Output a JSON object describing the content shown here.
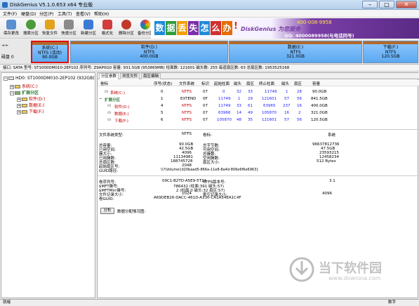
{
  "window": {
    "title": "DiskGenius V5.1.0.653 x64 专业版",
    "min": "–",
    "max": "□",
    "close": "✕"
  },
  "menu": [
    "文件(F)",
    "硬盘(D)",
    "分区(P)",
    "工具(T)",
    "查看(V)",
    "帮助(H)"
  ],
  "toolbar": [
    {
      "label": "保存更改",
      "color": "#5a8fd0"
    },
    {
      "label": "搜索分区",
      "color": "#4c9a3c"
    },
    {
      "label": "恢复文件",
      "color": "#e3a21a"
    },
    {
      "label": "快速分区",
      "color": "#8a8a8a"
    },
    {
      "label": "新建分区",
      "color": "#3a7bd5"
    },
    {
      "label": "格式化",
      "color": "#d23c3c"
    },
    {
      "label": "删除分区",
      "color": "#c0392b"
    },
    {
      "label": "备份分区",
      "color": "#2f7d3a"
    }
  ],
  "banner": {
    "tiles": [
      {
        "ch": "数",
        "color": "#1f8ad8"
      },
      {
        "ch": "据",
        "color": "#2e9e3e"
      },
      {
        "ch": "丢",
        "color": "#f0a000"
      },
      {
        "ch": "失",
        "color": "#7b2fa8"
      },
      {
        "ch": "怎",
        "color": "#1f8ad8"
      },
      {
        "ch": "么",
        "color": "#d0302f"
      },
      {
        "ch": "办",
        "color": "#e56c00"
      }
    ],
    "exclaim": "!",
    "brand": "DiskGenius 为您服务",
    "phone": "400-008-9958",
    "qq": "QQ: 4000089958(与电话同号)"
  },
  "disk": {
    "label": "磁盘 0",
    "partitions": [
      {
        "name": "系统(C:)",
        "fs": "NTFS (活动)",
        "size": "90.0GB",
        "selected": true
      },
      {
        "name": "软件(D:)",
        "fs": "NTFS",
        "size": "400.0GB",
        "selected": false
      },
      {
        "name": "数据(E:)",
        "fs": "NTFS",
        "size": "321.0GB",
        "selected": false
      },
      {
        "name": "下载(F:)",
        "fs": "NTFS",
        "size": "120.5GB",
        "selected": false
      }
    ]
  },
  "info_line": "接口: SATA  型号: ST1000DM010-2EP102  序列号: Z9AP0G0  容量: 931.5GB (953869MB)  柱面数: 121601  磁头数: 255  每道扇区数: 63  总扇区数: 1953525168",
  "tree": {
    "disk": "HD0: ST1000DM010-2EP102 (932GB)",
    "items": [
      {
        "label": "系统(C:)",
        "level": 1,
        "expander": "+"
      },
      {
        "label": "扩展分区",
        "level": 1,
        "expander": "−"
      },
      {
        "label": "软件(D:)",
        "level": 2,
        "expander": "+"
      },
      {
        "label": "数据(E:)",
        "level": 2,
        "expander": "+"
      },
      {
        "label": "下载(F:)",
        "level": 2,
        "expander": "+"
      }
    ]
  },
  "tabs": [
    "分区参数",
    "浏览文件",
    "扇区编辑"
  ],
  "table": {
    "headers": [
      "卷标",
      "序号(状态)",
      "文件系统",
      "标识",
      "起始柱面",
      "磁头",
      "扇区",
      "终止柱面",
      "磁头",
      "扇区",
      "容量"
    ],
    "rows": [
      {
        "cells": [
          "系统(C:)",
          "0",
          "NTFS",
          "07",
          "0",
          "32",
          "33",
          "11749",
          "1",
          "28",
          "90.0GB"
        ],
        "indent": 1,
        "color": "red"
      },
      {
        "cells": [
          "扩展分区",
          "1",
          "EXTEND",
          "0F",
          "11749",
          "1",
          "29",
          "121601",
          "57",
          "56",
          "841.5GB"
        ],
        "indent": 0,
        "color": "red"
      },
      {
        "cells": [
          "软件(D:)",
          "4",
          "NTFS",
          "07",
          "11749",
          "33",
          "61",
          "63965",
          "237",
          "16",
          "400.0GB"
        ],
        "indent": 2,
        "color": "red"
      },
      {
        "cells": [
          "数据(E:)",
          "5",
          "NTFS",
          "07",
          "63966",
          "14",
          "49",
          "105870",
          "16",
          "2",
          "321.0GB"
        ],
        "indent": 2,
        "color": "red"
      },
      {
        "cells": [
          "下载(F:)",
          "6",
          "NTFS",
          "07",
          "105870",
          "48",
          "35",
          "121601",
          "57",
          "56",
          "120.5GB"
        ],
        "indent": 2,
        "color": "red"
      }
    ]
  },
  "details": {
    "fs_type_label": "文件系统类型:",
    "fs_type": "NTFS",
    "vol_label": "卷标:",
    "vol": "系统",
    "left": [
      {
        "k": "总容量:",
        "v": "90.0GB"
      },
      {
        "k": "已用空间:",
        "v": "42.5GB"
      },
      {
        "k": "簇大小:",
        "v": "4096"
      },
      {
        "k": "已用簇数:",
        "v": "11134981"
      },
      {
        "k": "总扇区数:",
        "v": "188745728"
      },
      {
        "k": "起始扇区号:",
        "v": "2048"
      },
      {
        "k": "GUID路径:",
        "v": "\\\\?\\Volume{d20baad5-866a-11e8-8a4d-806e6f6e6963}"
      }
    ],
    "right": [
      {
        "k": "总字节数:",
        "v": "96637812736"
      },
      {
        "k": "可用空间:",
        "v": "47.5GB"
      },
      {
        "k": "总簇数:",
        "v": "23593215"
      },
      {
        "k": "空闲簇数:",
        "v": "12458234"
      },
      {
        "k": "扇区大小:",
        "v": "512 Bytes"
      }
    ],
    "serial_label": "卷序列号:",
    "serial": "09C1-B2TD-A5E9-5T3A",
    "ntfs_ver_label": "NTFS版本号:",
    "ntfs_ver": "3.1",
    "mft_label": "$MFT簇号:",
    "mft": "786432 (柱面:391 磁头:57)",
    "mftmirr_label": "$MFTMirr簇号:",
    "mftmirr": "2 (柱面:0 磁头:32 扇区:57)",
    "frs_label": "文件记录大小:",
    "frs": "1024",
    "idx_label": "索引记录大小:",
    "idx": "4096",
    "guid_label": "卷GUID:",
    "guid": "A69DEB26-DACC-461D-A330-CA1A54EA1C4F"
  },
  "analyze": {
    "button": "分析",
    "text": "数据分配情况图:"
  },
  "status": {
    "left": "就绪",
    "right": "数字"
  },
  "watermark": {
    "cn": "当下软件园",
    "url": "www.downxia.com"
  }
}
